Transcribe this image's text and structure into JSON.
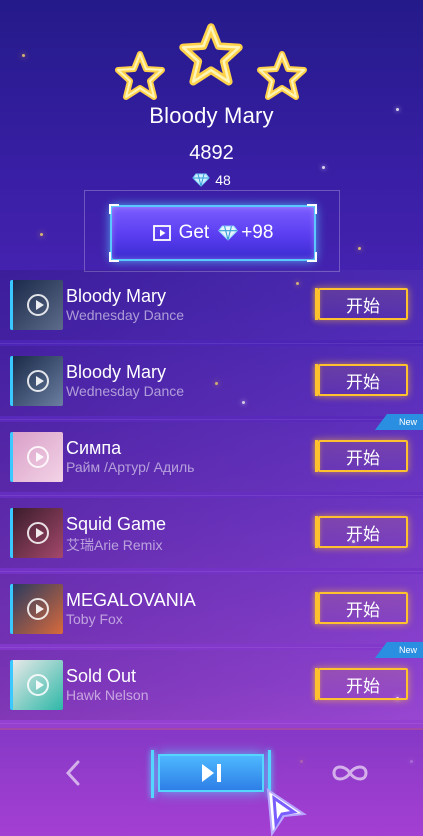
{
  "result": {
    "song_title": "Bloody Mary",
    "score": "4892",
    "gems": "48",
    "stars_earned": 3,
    "get_button_label": "Get",
    "get_button_bonus": "+98"
  },
  "songs": [
    {
      "title": "Bloody Mary",
      "artist": "Wednesday Dance",
      "button": "开始",
      "is_new": false,
      "cover_colors": [
        "#1b2a4a",
        "#5d6c8a"
      ]
    },
    {
      "title": "Bloody Mary",
      "artist": "Wednesday Dance",
      "button": "开始",
      "is_new": false,
      "cover_colors": [
        "#1a2a48",
        "#6b7fa2"
      ]
    },
    {
      "title": "Симпа",
      "artist": "Райм /Артур/ Адиль",
      "button": "开始",
      "is_new": true,
      "cover_colors": [
        "#d9a0c8",
        "#f3d3e6"
      ]
    },
    {
      "title": "Squid Game",
      "artist": "艾瑞Arie Remix",
      "button": "开始",
      "is_new": false,
      "cover_colors": [
        "#3b1d2a",
        "#a4486c"
      ]
    },
    {
      "title": "MEGALOVANIA",
      "artist": "Toby Fox",
      "button": "开始",
      "is_new": false,
      "cover_colors": [
        "#2b3b5f",
        "#d86a3c"
      ]
    },
    {
      "title": "Sold Out",
      "artist": "Hawk Nelson",
      "button": "开始",
      "is_new": true,
      "cover_colors": [
        "#e8e8e8",
        "#2db8a7"
      ]
    }
  ],
  "new_badge_label": "New",
  "nav": {
    "back_icon": "chevron-left-icon",
    "play_icon": "play-next-icon",
    "loop_icon": "infinity-loop-icon"
  },
  "colors": {
    "accent_yellow": "#ffc22e",
    "accent_cyan": "#55d6ff"
  }
}
